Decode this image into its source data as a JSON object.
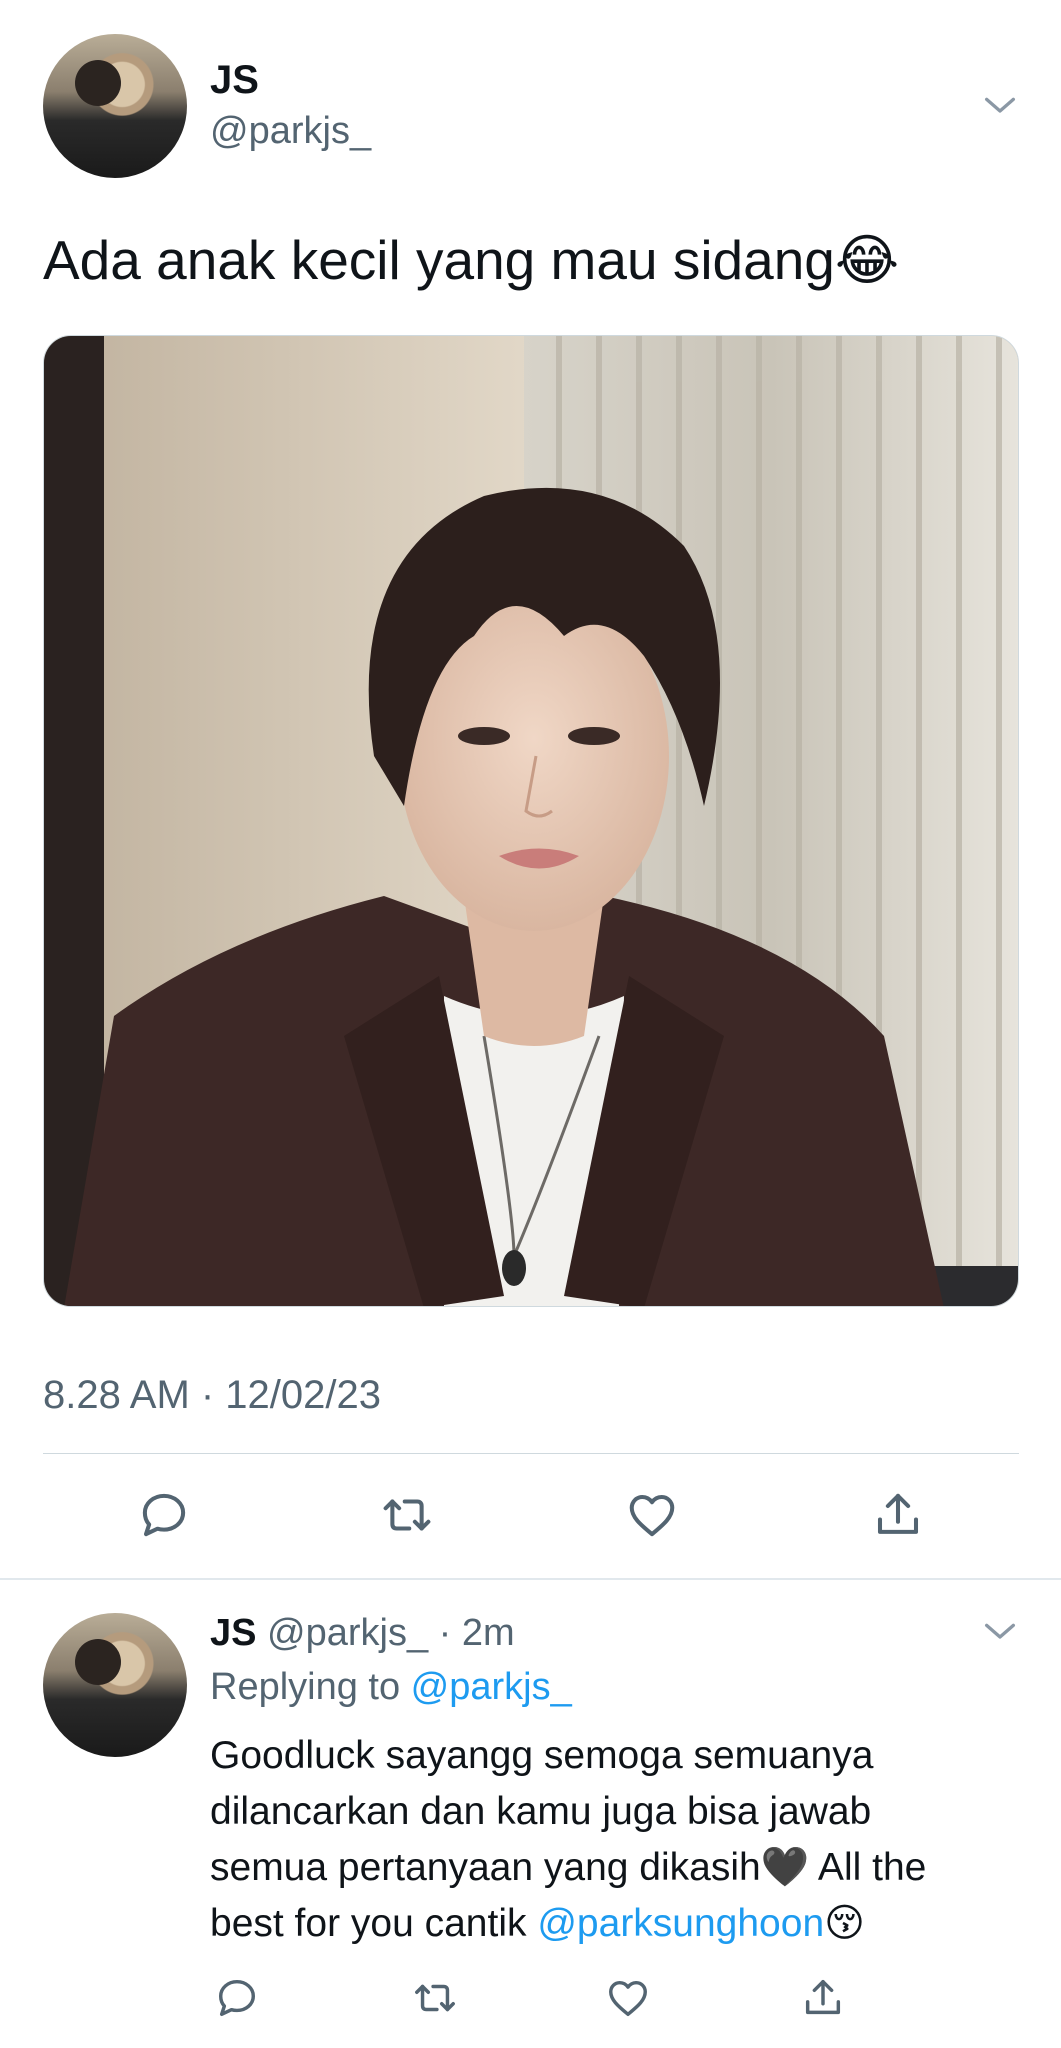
{
  "main_tweet": {
    "author_name": "JS",
    "author_handle": "@parkjs_",
    "text": "Ada anak kecil yang mau sidang😂",
    "timestamp": "8.28 AM · 12/02/23"
  },
  "reply": {
    "author_name": "JS",
    "author_handle": "@parkjs_",
    "separator": " · ",
    "age": "2m",
    "replying_to_label": "Replying to ",
    "replying_to_handle": "@parkjs_",
    "text_lines": [
      "Goodluck sayangg semoga semuanya",
      "dilancarkan dan kamu juga bisa jawab",
      "semua pertanyaan yang dikasih🖤 All the"
    ],
    "text_last_prefix": "best for you cantik ",
    "mention": "@parksunghoon",
    "text_last_suffix": "😚"
  },
  "icons": {
    "chevron": "chevron-down-icon",
    "reply": "reply-icon",
    "retweet": "retweet-icon",
    "like": "heart-icon",
    "share": "share-icon"
  },
  "colors": {
    "text_primary": "#0f1419",
    "text_secondary": "#536471",
    "link": "#1d9bf0",
    "divider": "#cfd9de"
  }
}
